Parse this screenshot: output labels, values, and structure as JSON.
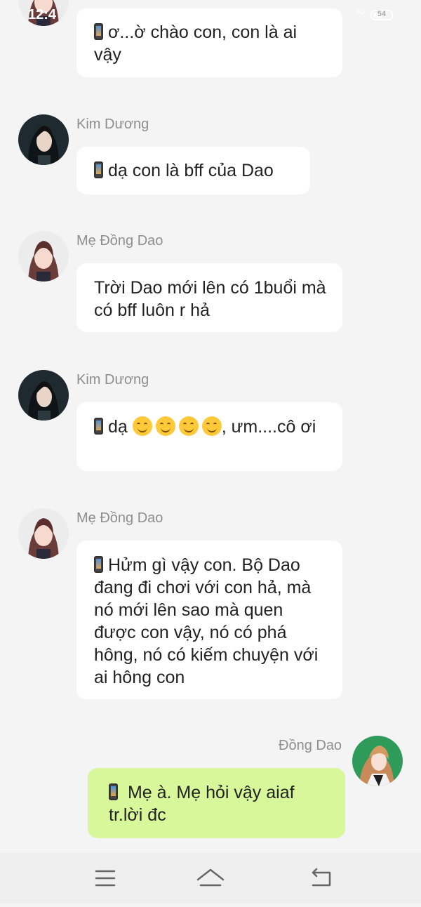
{
  "status_bar": {
    "time": "12:4",
    "network": "4G",
    "battery": "54",
    "battery_level": 0.54
  },
  "messages": [
    {
      "sender": "",
      "side": "left",
      "avatar": "avatar-me-dong-dao",
      "text": "ơ...ờ chào con, con là ai vậy",
      "phone_icon": true
    },
    {
      "sender": "Kim Dương",
      "side": "left",
      "avatar": "avatar-kim-duong",
      "text": "dạ con là bff của Dao",
      "phone_icon": true
    },
    {
      "sender": "Mẹ Đồng Dao",
      "side": "left",
      "avatar": "avatar-me-dong-dao",
      "text": "Trời Dao mới lên có 1buổi mà có bff luôn r hả",
      "phone_icon": false
    },
    {
      "sender": "Kim Dương",
      "side": "left",
      "avatar": "avatar-kim-duong",
      "text_prefix": "dạ",
      "emoji_count": 4,
      "text_suffix": ", ưm....cô ơi",
      "phone_icon": true
    },
    {
      "sender": "Mẹ Đồng Dao",
      "side": "left",
      "avatar": "avatar-me-dong-dao",
      "text": "Hửm gì vậy con. Bộ Dao đang đi chơi với con hả, mà nó mới lên sao mà quen được con vậy, nó có phá hông, nó có kiếm chuyện với ai hông con",
      "phone_icon": true
    },
    {
      "sender": "Đồng Dao",
      "side": "right",
      "avatar": "avatar-dong-dao",
      "text": " Mẹ à. Mẹ hỏi vậy aiaf tr.lời đc",
      "phone_icon": true
    }
  ],
  "nav": {
    "menu": "menu-icon",
    "home": "home-icon",
    "back": "back-icon"
  },
  "colors": {
    "background": "#f4f4f4",
    "bubble_other": "#ffffff",
    "bubble_self": "#d7f79a",
    "name": "#8e8e8e"
  }
}
